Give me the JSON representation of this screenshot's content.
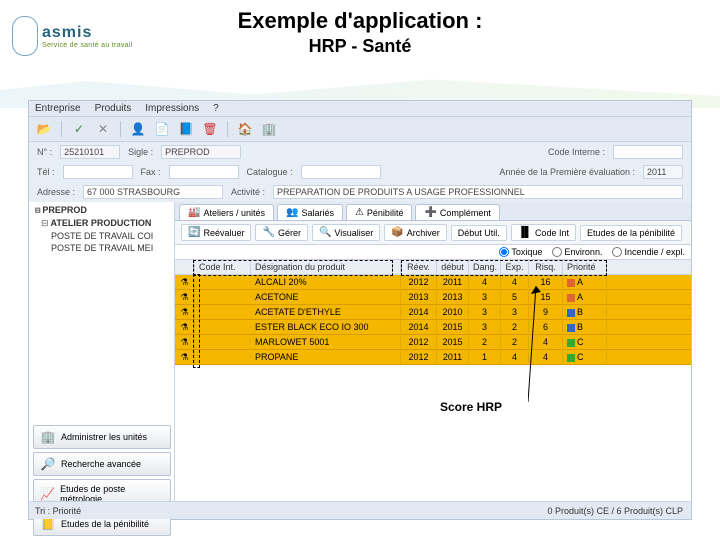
{
  "slide": {
    "title": "Exemple d'application :",
    "subtitle": "HRP - Santé"
  },
  "logo": {
    "text": "asmis",
    "sub": "Service de santé au travail"
  },
  "menubar": [
    "Entreprise",
    "Produits",
    "Impressions",
    "?"
  ],
  "info": {
    "num_label": "N° :",
    "num": "25210101",
    "sigle_label": "Sigle :",
    "sigle": "PREPROD",
    "codeint_label": "Code Interne :",
    "tel_label": "Tél :",
    "fax_label": "Fax :",
    "catalogue_label": "Catalogue :",
    "annee_label": "Année de la Première évaluation :",
    "annee": "2011",
    "adresse_label": "Adresse :",
    "adresse": "67 000 STRASBOURG",
    "activite_label": "Activité :",
    "activite": "PREPARATION DE PRODUITS A USAGE PROFESSIONNEL"
  },
  "tree": {
    "root": "PREPROD",
    "unit": "ATELIER PRODUCTION",
    "posts": [
      "POSTE DE TRAVAIL COI",
      "POSTE DE TRAVAIL MEI"
    ]
  },
  "tabs": [
    "Ateliers / unités",
    "Salariés",
    "Pénibilité",
    "Complément"
  ],
  "sub_toolbar": [
    "Reévaluer",
    "Gérer",
    "Visualiser",
    "Archiver",
    "Début Util.",
    "Code Int",
    "Etudes de la pénibilité"
  ],
  "filters": [
    "Toxique",
    "Environn.",
    "Incendie / expl."
  ],
  "grid": {
    "headers": [
      "",
      "Code Int.",
      "Désignation du produit",
      "Réev.",
      "début",
      "Dang.",
      "Exp.",
      "Risq.",
      "Priorité"
    ],
    "rows": [
      {
        "des": "ALCALI 20%",
        "reev": "2012",
        "deb": "2011",
        "dang": "4",
        "exp": "4",
        "risq": "16",
        "prio": "A",
        "col": "red"
      },
      {
        "des": "ACETONE",
        "reev": "2013",
        "deb": "2013",
        "dang": "3",
        "exp": "5",
        "risq": "15",
        "prio": "A",
        "col": "red"
      },
      {
        "des": "ACETATE D'ETHYLE",
        "reev": "2014",
        "deb": "2010",
        "dang": "3",
        "exp": "3",
        "risq": "9",
        "prio": "B",
        "col": "blue"
      },
      {
        "des": "ESTER BLACK ECO IO 300",
        "reev": "2014",
        "deb": "2015",
        "dang": "3",
        "exp": "2",
        "risq": "6",
        "prio": "B",
        "col": "blue"
      },
      {
        "des": "MARLOWET 5001",
        "reev": "2012",
        "deb": "2015",
        "dang": "2",
        "exp": "2",
        "risq": "4",
        "prio": "C",
        "col": "green"
      },
      {
        "des": "PROPANE",
        "reev": "2012",
        "deb": "2011",
        "dang": "1",
        "exp": "4",
        "risq": "4",
        "prio": "C",
        "col": "green"
      }
    ]
  },
  "left_buttons": [
    "Administrer les unités",
    "Recherche avancée",
    "Etudes de poste métrologie",
    "Etudes de la pénibilité"
  ],
  "statusbar": {
    "left": "Tri : Priorité",
    "right": "0 Produit(s) CE / 6 Produit(s) CLP"
  },
  "annotation": {
    "score": "Score HRP"
  }
}
